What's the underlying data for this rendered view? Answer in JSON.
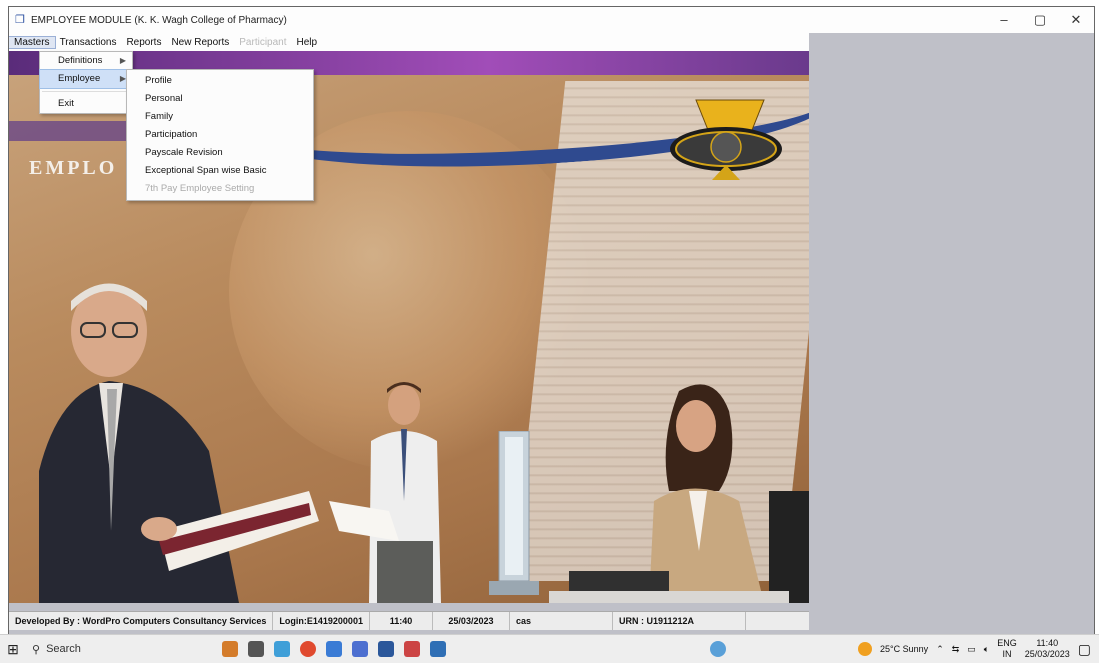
{
  "window": {
    "title": "EMPLOYEE MODULE  (K. K. Wagh College of Pharmacy)",
    "minimize": "–",
    "maximize": "▢",
    "close": "✕"
  },
  "menubar": {
    "items": [
      {
        "label": "Masters",
        "state": "active"
      },
      {
        "label": "Transactions",
        "state": "normal"
      },
      {
        "label": "Reports",
        "state": "normal"
      },
      {
        "label": "New Reports",
        "state": "normal"
      },
      {
        "label": "Participant",
        "state": "disabled"
      },
      {
        "label": "Help",
        "state": "normal"
      }
    ]
  },
  "masters_menu": {
    "definitions": "Definitions",
    "employee": "Employee",
    "exit": "Exit"
  },
  "employee_submenu": {
    "items": [
      "Profile",
      "Personal",
      "Family",
      "Participation",
      "Payscale Revision",
      "Exceptional Span wise Basic"
    ],
    "disabled_item": "7th Pay Employee Setting"
  },
  "banner": {
    "text": "EMPLO"
  },
  "status": {
    "developer": "Developed By : WordPro Computers Consultancy Services",
    "login": "Login:E1419200001",
    "time": "11:40",
    "date": "25/03/2023",
    "user": "cas",
    "urn": "URN : U1911212A"
  },
  "taskbar": {
    "search": "Search",
    "weather": "25°C  Sunny",
    "lang_top": "ENG",
    "lang_bottom": "IN",
    "clock_time": "11:40",
    "clock_date": "25/03/2023"
  },
  "colors": {
    "menu_selected": "#cfe0f7",
    "scene_purple": "#a14db8",
    "scene_blue": "#2f4a8f"
  }
}
